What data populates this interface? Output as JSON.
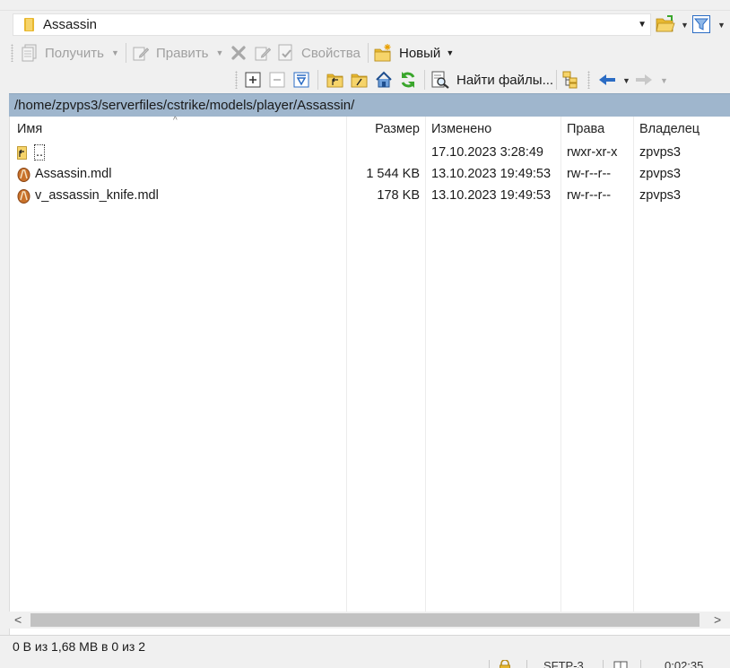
{
  "path_combo": {
    "value": "Assassin"
  },
  "toolbar1": {
    "get_label": "Получить",
    "edit_label": "Править",
    "properties_label": "Свойства",
    "new_label": "Новый"
  },
  "toolbar2": {
    "find_label": "Найти файлы..."
  },
  "current_path": "/home/zpvps3/serverfiles/cstrike/models/player/Assassin/",
  "columns": [
    "Имя",
    "Размер",
    "Изменено",
    "Права",
    "Владелец"
  ],
  "files": [
    {
      "name": "..",
      "size": "",
      "modified": "17.10.2023 3:28:49",
      "rights": "rwxr-xr-x",
      "owner": "zpvps3",
      "icon": "parent-folder-icon"
    },
    {
      "name": "Assassin.mdl",
      "size": "1 544 KB",
      "modified": "13.10.2023 19:49:53",
      "rights": "rw-r--r--",
      "owner": "zpvps3",
      "icon": "mdl-file-icon"
    },
    {
      "name": "v_assassin_knife.mdl",
      "size": "178 KB",
      "modified": "13.10.2023 19:49:53",
      "rights": "rw-r--r--",
      "owner": "zpvps3",
      "icon": "mdl-file-icon"
    }
  ],
  "status": {
    "selection": "0 B из 1,68 MB в 0 из 2",
    "protocol": "SFTP-3",
    "time": "0:02:35"
  },
  "colors": {
    "path_bar": "#9fb6cd",
    "accent_blue": "#2b6cc4",
    "refresh_green": "#3aa62c"
  }
}
